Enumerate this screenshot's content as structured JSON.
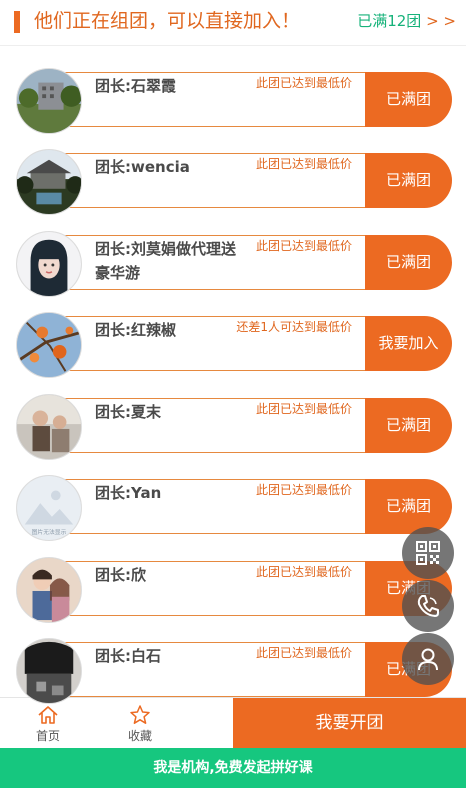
{
  "header": {
    "title": "他们正在组团，可以直接加入！",
    "full_count": "已满12团",
    "arrows": " > >"
  },
  "groups": [
    {
      "leader": "团长:石翠霞",
      "note": "此团已达到最低价",
      "button": "已满团",
      "avatar": "outdoor-building-photo"
    },
    {
      "leader": "团长:wencia",
      "note": "此团已达到最低价",
      "button": "已满团",
      "avatar": "landscape-photo"
    },
    {
      "leader": "团长:刘莫娟做代理送豪华游",
      "note": "此团已达到最低价",
      "button": "已满团",
      "avatar": "girl-portrait-photo"
    },
    {
      "leader": "团长:红辣椒",
      "note": "还差1人可达到最低价",
      "button": "我要加入",
      "avatar": "fruit-tree-photo"
    },
    {
      "leader": "团长:夏末",
      "note": "此团已达到最低价",
      "button": "已满团",
      "avatar": "people-photo"
    },
    {
      "leader": "团长:Yan",
      "note": "此团已达到最低价",
      "button": "已满团",
      "avatar": "placeholder-image",
      "avatar_text": "图片无法显示"
    },
    {
      "leader": "团长:欣",
      "note": "此团已达到最低价",
      "button": "已满团",
      "avatar": "couple-illustration"
    },
    {
      "leader": "团长:白石",
      "note": "此团已达到最低价",
      "button": "已满团",
      "avatar": "person-photo"
    }
  ],
  "floating": {
    "qr": "qr-code-icon",
    "phone": "phone-icon",
    "user": "user-icon"
  },
  "bottom_nav": {
    "home_label": "首页",
    "fav_label": "收藏",
    "open_label": "我要开团"
  },
  "org_bar": "我是机构,免费发起拼好课",
  "colors": {
    "accent": "#ec6a22",
    "green": "#16c77f"
  }
}
